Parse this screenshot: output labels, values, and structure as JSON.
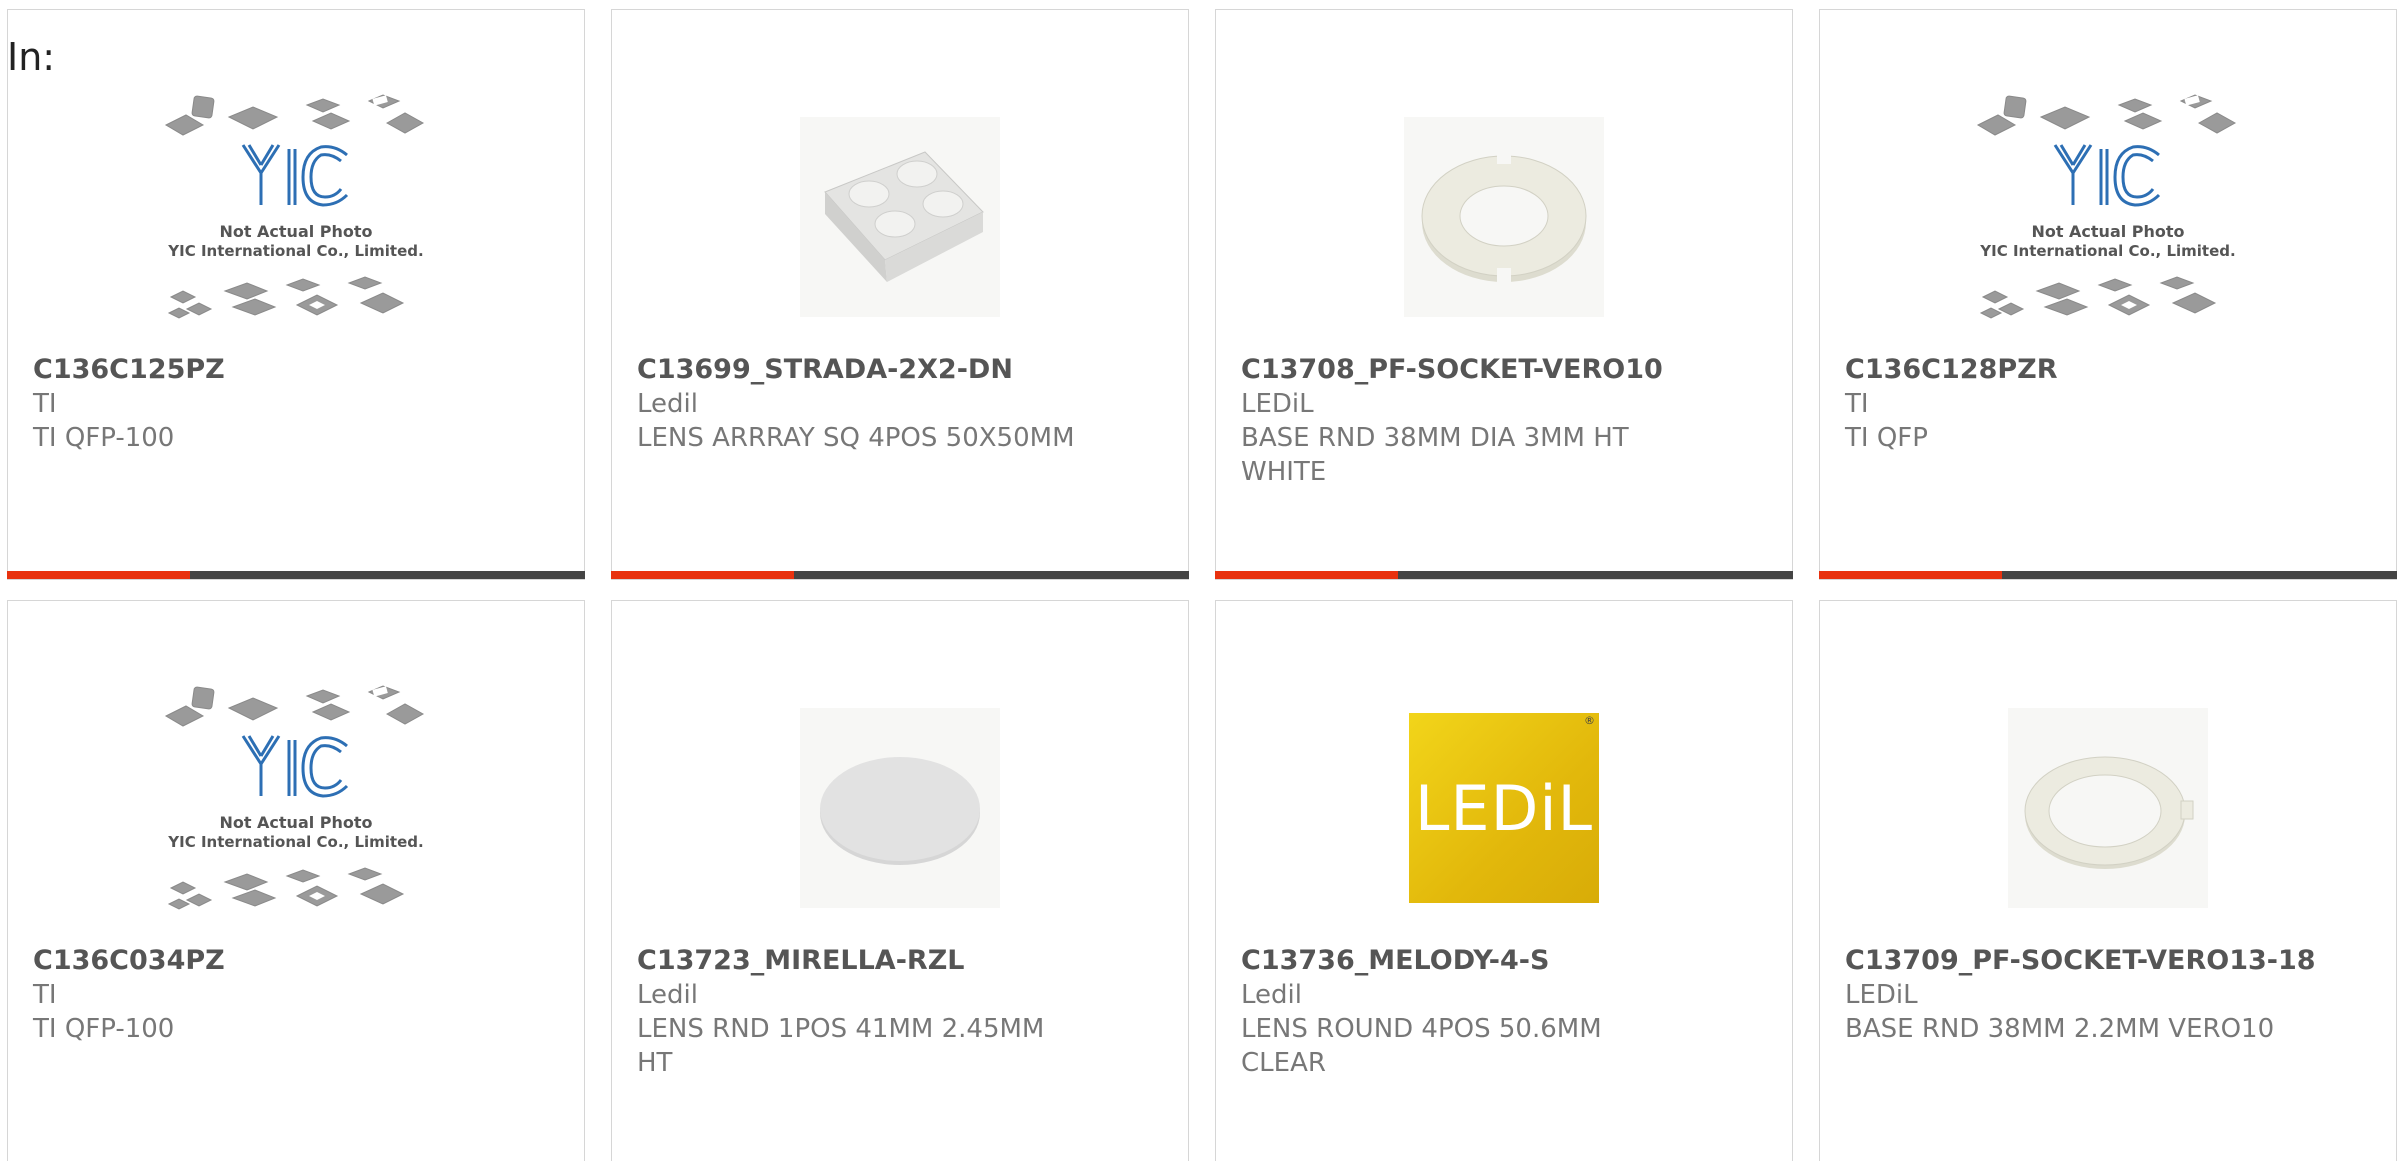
{
  "header": {
    "in_label": "In:"
  },
  "placeholder": {
    "logo_text": "YIC",
    "line1": "Not Actual Photo",
    "line2": "YIC International Co., Limited."
  },
  "brand_logo_text": "LEDiL",
  "accent_color": "#e8320f",
  "bar_color": "#444444",
  "products": [
    {
      "part": "C136C125PZ",
      "manufacturer": "TI",
      "description": "TI QFP-100",
      "image": "yic-placeholder"
    },
    {
      "part": "C13699_STRADA-2X2-DN",
      "manufacturer": "Ledil",
      "description": "LENS ARRRAY SQ 4POS 50X50MM",
      "image": "lens-array-2x2"
    },
    {
      "part": "C13708_PF-SOCKET-VERO10",
      "manufacturer": "LEDiL",
      "description": "BASE RND 38MM DIA 3MM HT WHITE",
      "image": "socket-ring"
    },
    {
      "part": "C136C128PZR",
      "manufacturer": "TI",
      "description": "TI QFP",
      "image": "yic-placeholder"
    },
    {
      "part": "C136C034PZ",
      "manufacturer": "TI",
      "description": "TI QFP-100",
      "image": "yic-placeholder"
    },
    {
      "part": "C13723_MIRELLA-RZL",
      "manufacturer": "Ledil",
      "description": "LENS RND 1POS 41MM 2.45MM HT",
      "image": "round-lens"
    },
    {
      "part": "C13736_MELODY-4-S",
      "manufacturer": "Ledil",
      "description": "LENS ROUND 4POS 50.6MM CLEAR",
      "image": "ledil-logo"
    },
    {
      "part": "C13709_PF-SOCKET-VERO13-18",
      "manufacturer": "LEDiL",
      "description": "BASE RND 38MM 2.2MM VERO10",
      "image": "socket-ring-thin"
    }
  ]
}
